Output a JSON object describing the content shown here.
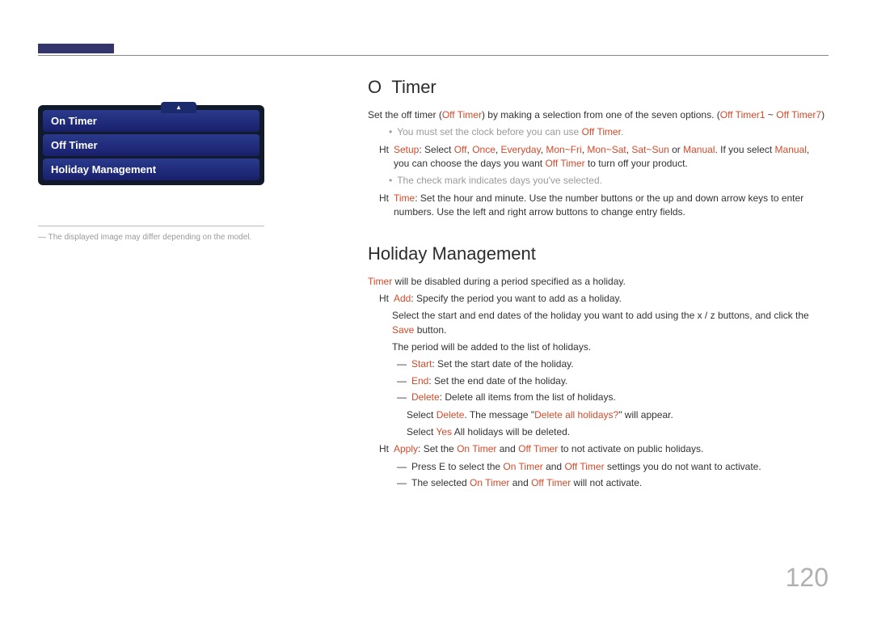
{
  "header": {},
  "sidebar": {
    "menu": {
      "arrow_glyph": "▴",
      "items": [
        {
          "label": "On Timer"
        },
        {
          "label": "Off Timer"
        },
        {
          "label": "Holiday Management"
        }
      ]
    },
    "note_prefix": "―",
    "note": "The displayed image may differ depending on the model."
  },
  "section_off_timer": {
    "heading_prefix": "O",
    "heading": "Timer",
    "intro_a": "Set the off timer (",
    "intro_hl1": "Off Timer",
    "intro_b": ") by making a selection from one of the seven options. (",
    "intro_hl2": "Off Timer1",
    "intro_tilde": " ~ ",
    "intro_hl3": "Off Timer7",
    "intro_c": ")",
    "clock_bullet": "•",
    "clock_note_a": "You must set the clock before you can use ",
    "clock_note_hl": "Off Timer",
    "clock_note_b": ".",
    "setup_marker": "Ht",
    "setup_hl": "Setup",
    "setup_a": ": Select ",
    "setup_opt1": "Off",
    "setup_c1": ", ",
    "setup_opt2": "Once",
    "setup_c2": ", ",
    "setup_opt3": "Everyday",
    "setup_c3": ", ",
    "setup_opt4": "Mon~Fri",
    "setup_c4": ", ",
    "setup_opt5": "Mon~Sat",
    "setup_c5": ", ",
    "setup_opt6": "Sat~Sun",
    "setup_or": " or ",
    "setup_opt7": "Manual",
    "setup_b": ". If you select ",
    "setup_opt7b": "Manual",
    "setup_c": ", you can choose the days you want ",
    "setup_opt8": "Off Timer",
    "setup_d": " to turn off your product.",
    "check_bullet": "•",
    "check_note": "The check mark indicates days you've selected.",
    "time_marker": "Ht",
    "time_hl": "Time",
    "time_text": ": Set the hour and minute. Use the number buttons or the up and down arrow keys to enter numbers. Use the left and right arrow buttons to change entry fields."
  },
  "section_holiday": {
    "heading": "Holiday Management",
    "intro_hl": "Timer",
    "intro_text": " will be disabled during a period specified as a holiday.",
    "add_marker": "Ht",
    "add_hl": "Add",
    "add_text": ": Specify the period you want to add as a holiday.",
    "add_line2_a": "Select the start and end dates of the holiday you want to add using the ",
    "add_line2_xz": "x / z",
    "add_line2_b": " buttons, and click the ",
    "add_line2_save": "Save",
    "add_line2_c": " button.",
    "add_line3": "The period will be added to the list of holidays.",
    "start_dash": "―",
    "start_hl": "Start",
    "start_text": ": Set the start date of the holiday.",
    "end_dash": "―",
    "end_hl": "End",
    "end_text": ": Set the end date of the holiday.",
    "delete_dash": "―",
    "delete_hl": "Delete",
    "delete_text": ": Delete all items from the list of holidays.",
    "delete2_a": "Select ",
    "delete2_hl1": "Delete",
    "delete2_b": ". The message \"",
    "delete2_hl2": "Delete all holidays?",
    "delete2_c": "\" will appear.",
    "delete3_a": "Select ",
    "delete3_hl": "Yes",
    "delete3_b": " All holidays will be deleted.",
    "apply_marker": "Ht",
    "apply_hl": "Apply",
    "apply_a": ": Set the ",
    "apply_hl2": "On Timer",
    "apply_and": " and ",
    "apply_hl3": "Off Timer",
    "apply_b": " to not activate on public holidays.",
    "apply_sub_dash": "―",
    "apply_sub_a": "Press ",
    "apply_sub_e": "E",
    "apply_sub_b": " to select the ",
    "apply_sub_hl1": "On Timer",
    "apply_sub_and": " and ",
    "apply_sub_hl2": "Off Timer",
    "apply_sub_c": " settings you do not want to activate.",
    "apply_sub2_dash": "―",
    "apply_sub2_a": "The selected ",
    "apply_sub2_hl1": "On Timer",
    "apply_sub2_and": " and ",
    "apply_sub2_hl2": "Off Timer",
    "apply_sub2_b": " will not activate."
  },
  "page_number": "120"
}
